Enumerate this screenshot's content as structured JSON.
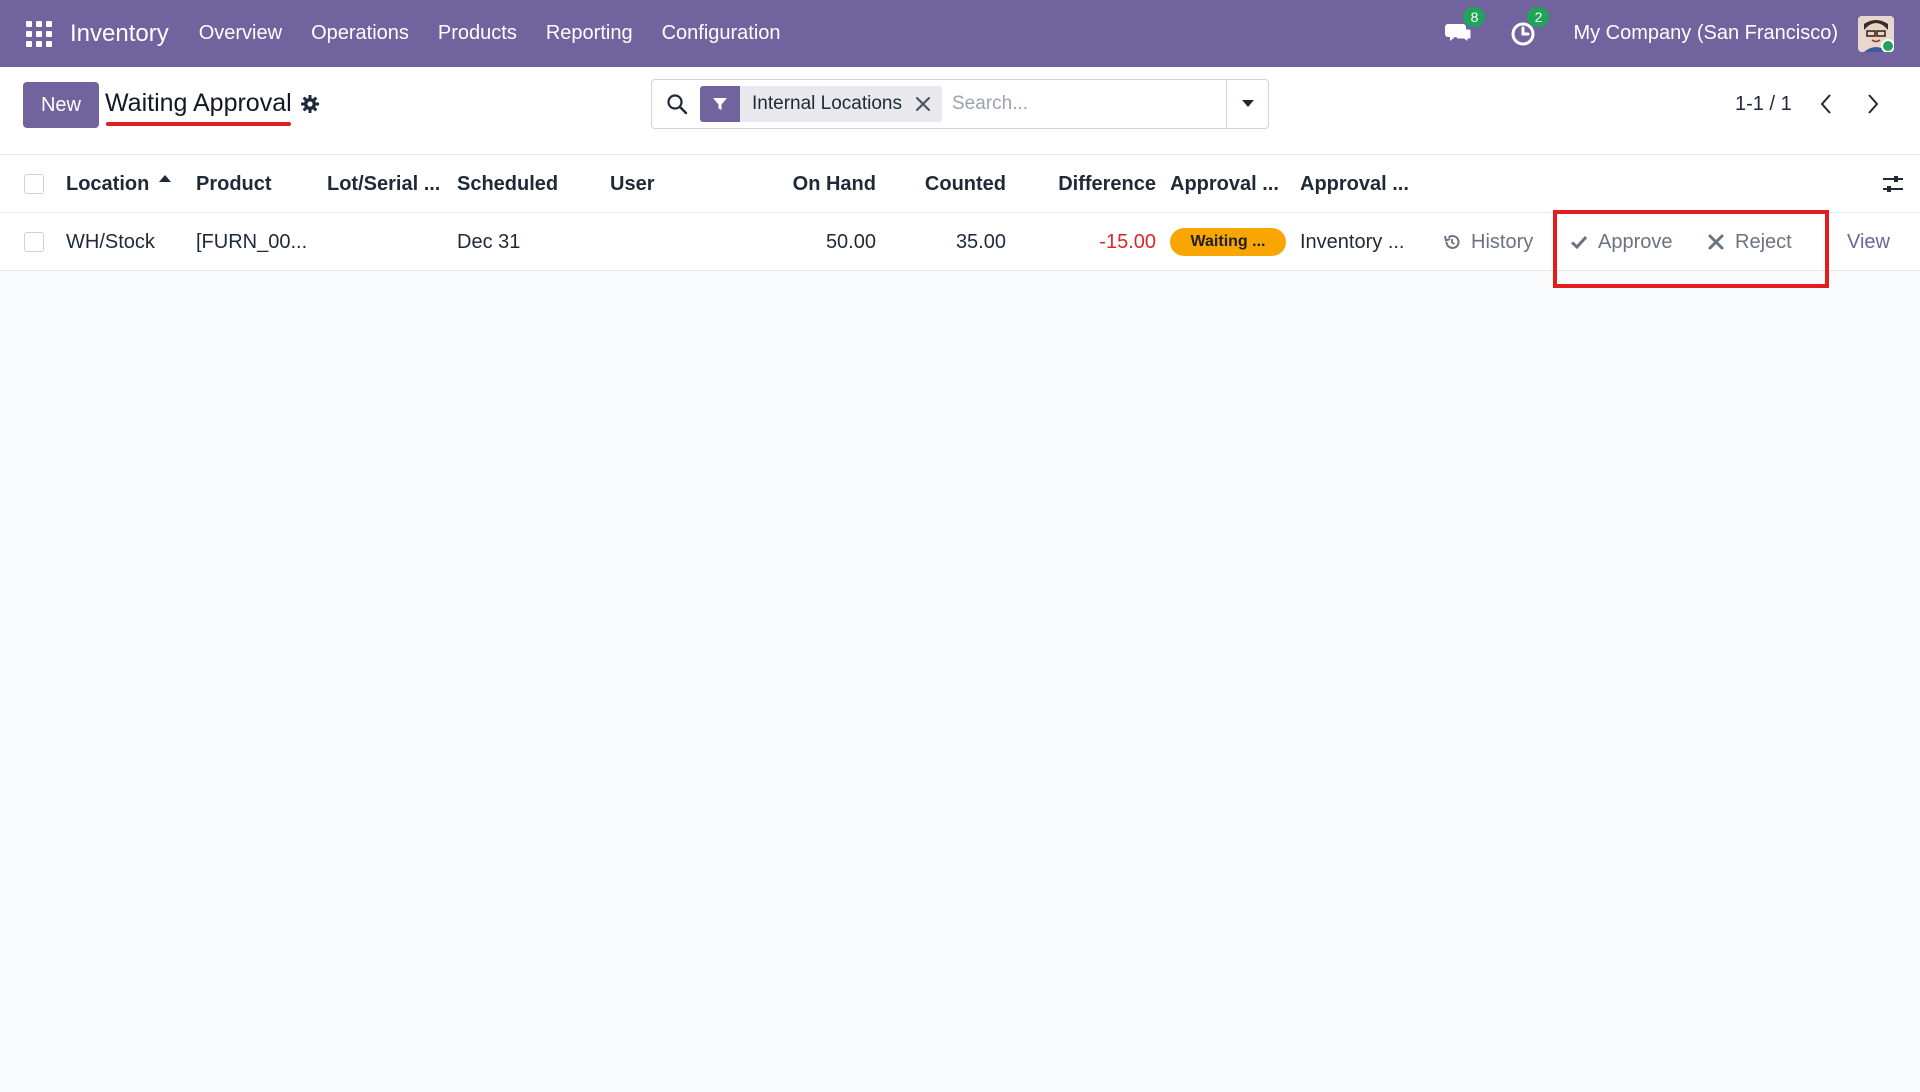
{
  "navbar": {
    "app_name": "Inventory",
    "menu": [
      "Overview",
      "Operations",
      "Products",
      "Reporting",
      "Configuration"
    ],
    "messages_count": "8",
    "activities_count": "2",
    "company": "My Company (San Francisco)",
    "color": "#71639e"
  },
  "control_panel": {
    "new_label": "New",
    "title": "Waiting Approval",
    "search": {
      "facet": "Internal Locations",
      "placeholder": "Search..."
    },
    "pager": "1-1 / 1"
  },
  "table": {
    "columns": {
      "location": "Location",
      "product": "Product",
      "lot": "Lot/Serial ...",
      "scheduled": "Scheduled",
      "user": "User",
      "on_hand": "On Hand",
      "counted": "Counted",
      "difference": "Difference",
      "approval_state": "Approval ...",
      "approval_by": "Approval ..."
    },
    "rows": [
      {
        "location": "WH/Stock",
        "product": "[FURN_00...",
        "lot": "",
        "scheduled": "Dec 31",
        "user": "",
        "on_hand": "50.00",
        "counted": "35.00",
        "difference": "-15.00",
        "approval_state": "Waiting ...",
        "approval_by": "Inventory ...",
        "history_label": "History",
        "approve_label": "Approve",
        "reject_label": "Reject",
        "view_label": "View"
      }
    ]
  },
  "icons": [
    "apps-icon",
    "chat-icon",
    "clock-icon",
    "avatar",
    "gear-icon",
    "search-icon",
    "filter-icon",
    "close-icon",
    "caret-down-icon",
    "chevron-left-icon",
    "chevron-right-icon",
    "settings-sliders-icon",
    "history-icon",
    "check-icon",
    "x-icon"
  ],
  "colors": {
    "brand": "#71639e",
    "badge": "#22a35a",
    "warning": "#f9a602",
    "negative": "#dc2626",
    "annotation": "#e11d1d"
  }
}
